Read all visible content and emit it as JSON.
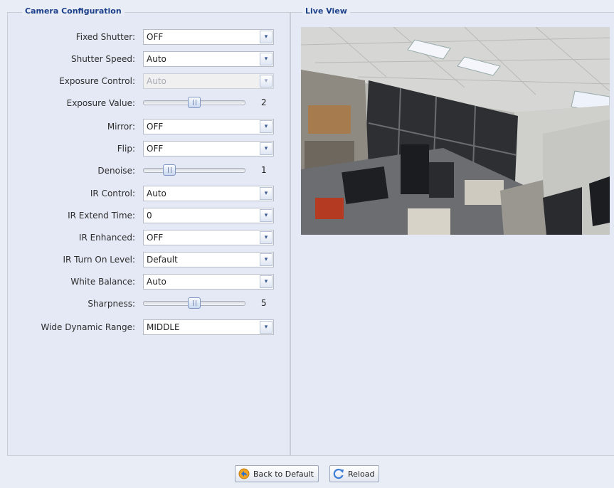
{
  "camera_config": {
    "title": "Camera Configuration",
    "fields": [
      {
        "label": "Fixed Shutter:",
        "type": "select",
        "value": "OFF"
      },
      {
        "label": "Shutter Speed:",
        "type": "select",
        "value": "Auto"
      },
      {
        "label": "Exposure Control:",
        "type": "select",
        "value": "Auto",
        "disabled": true
      },
      {
        "label": "Exposure Value:",
        "type": "slider",
        "value": "2",
        "level": 0.5
      },
      {
        "label": "Mirror:",
        "type": "select",
        "value": "OFF"
      },
      {
        "label": "Flip:",
        "type": "select",
        "value": "OFF"
      },
      {
        "label": "Denoise:",
        "type": "slider",
        "value": "1",
        "level": 0.25
      },
      {
        "label": "IR Control:",
        "type": "select",
        "value": "Auto"
      },
      {
        "label": "IR Extend Time:",
        "type": "select",
        "value": "0"
      },
      {
        "label": "IR Enhanced:",
        "type": "select",
        "value": "OFF"
      },
      {
        "label": "IR Turn On Level:",
        "type": "select",
        "value": "Default"
      },
      {
        "label": "White Balance:",
        "type": "select",
        "value": "Auto"
      },
      {
        "label": "Sharpness:",
        "type": "slider",
        "value": "5",
        "level": 0.5
      },
      {
        "label": "Wide Dynamic Range:",
        "type": "select",
        "value": "MIDDLE"
      }
    ]
  },
  "live_view": {
    "title": "Live View"
  },
  "buttons": {
    "back_to_default": "Back to Default",
    "reload": "Reload"
  },
  "icons": {
    "back_to_default": "undo-arrow-icon",
    "reload": "refresh-icon",
    "dropdown": "chevron-down-icon"
  },
  "colors": {
    "legend": "#1c3f8a",
    "background": "#e9edf6"
  }
}
